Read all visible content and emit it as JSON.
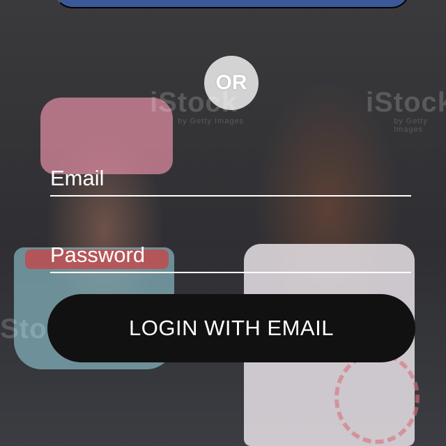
{
  "top_button": {
    "label": ""
  },
  "divider": {
    "label": "OR"
  },
  "email": {
    "placeholder": "Email",
    "value": ""
  },
  "password": {
    "placeholder": "Password",
    "value": ""
  },
  "login_button": {
    "label": "LOGIN WITH EMAIL"
  },
  "background": {
    "watermarks": [
      "iStock",
      "iStock",
      "iStock",
      "by Getty Images",
      "by Getty Images"
    ]
  },
  "colors": {
    "top_button": "#3b5998",
    "login_button": "#111111",
    "text": "#ffffff"
  }
}
